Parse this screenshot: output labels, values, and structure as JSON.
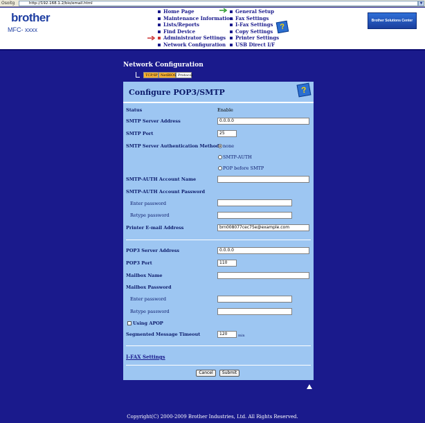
{
  "browser": {
    "address_label": "Osoitg",
    "url": "http://192.168.1.2/bio/email.html"
  },
  "brand": {
    "logo": "brother",
    "model": "MFC- xxxx"
  },
  "nav_left": [
    "Home Page",
    "Maintenance Information",
    "Lists/Reports",
    "Find Device",
    "Administrator Settings",
    "Network Configuration"
  ],
  "nav_right": [
    "General Setup",
    "Fax Settings",
    "I-Fax Settings",
    "Copy Settings",
    "Printer Settings",
    "USB Direct I/F"
  ],
  "solutions_center": "Brother Solutions Center",
  "section_title": "Network Configuration",
  "tabs": [
    "TCP/IP",
    "NetBIOS",
    "Protocol"
  ],
  "panel": {
    "title": "Configure POP3/SMTP",
    "status_label": "Status",
    "status_value": "Enable",
    "smtp_server_label": "SMTP Server Address",
    "smtp_server_value": "0.0.0.0",
    "smtp_port_label": "SMTP Port",
    "smtp_port_value": "25",
    "smtp_auth_label": "SMTP Server Authentication Method",
    "auth_options": [
      "none",
      "SMTP-AUTH",
      "POP before SMTP"
    ],
    "smtp_auth_account_label": "SMTP-AUTH Account Name",
    "smtp_auth_password_label": "SMTP-AUTH Account Password",
    "enter_password": "Enter password",
    "retype_password": "Retype password",
    "email_label": "Printer E-mail Address",
    "email_value": "brn008077cec75e@example.com",
    "pop3_server_label": "POP3 Server Address",
    "pop3_server_value": "0.0.0.0",
    "pop3_port_label": "POP3 Port",
    "pop3_port_value": "110",
    "mailbox_name_label": "Mailbox Name",
    "mailbox_password_label": "Mailbox Password",
    "apop_label": "Using APOP",
    "timeout_label": "Segmented Message Timeout",
    "timeout_value": "120",
    "timeout_unit": "min",
    "ifax_link": "I-FAX Settings",
    "cancel": "Cancel",
    "submit": "Submit"
  },
  "footer": "Copyright(C) 2000-2009 Brother Industries, Ltd. All Rights Reserved."
}
